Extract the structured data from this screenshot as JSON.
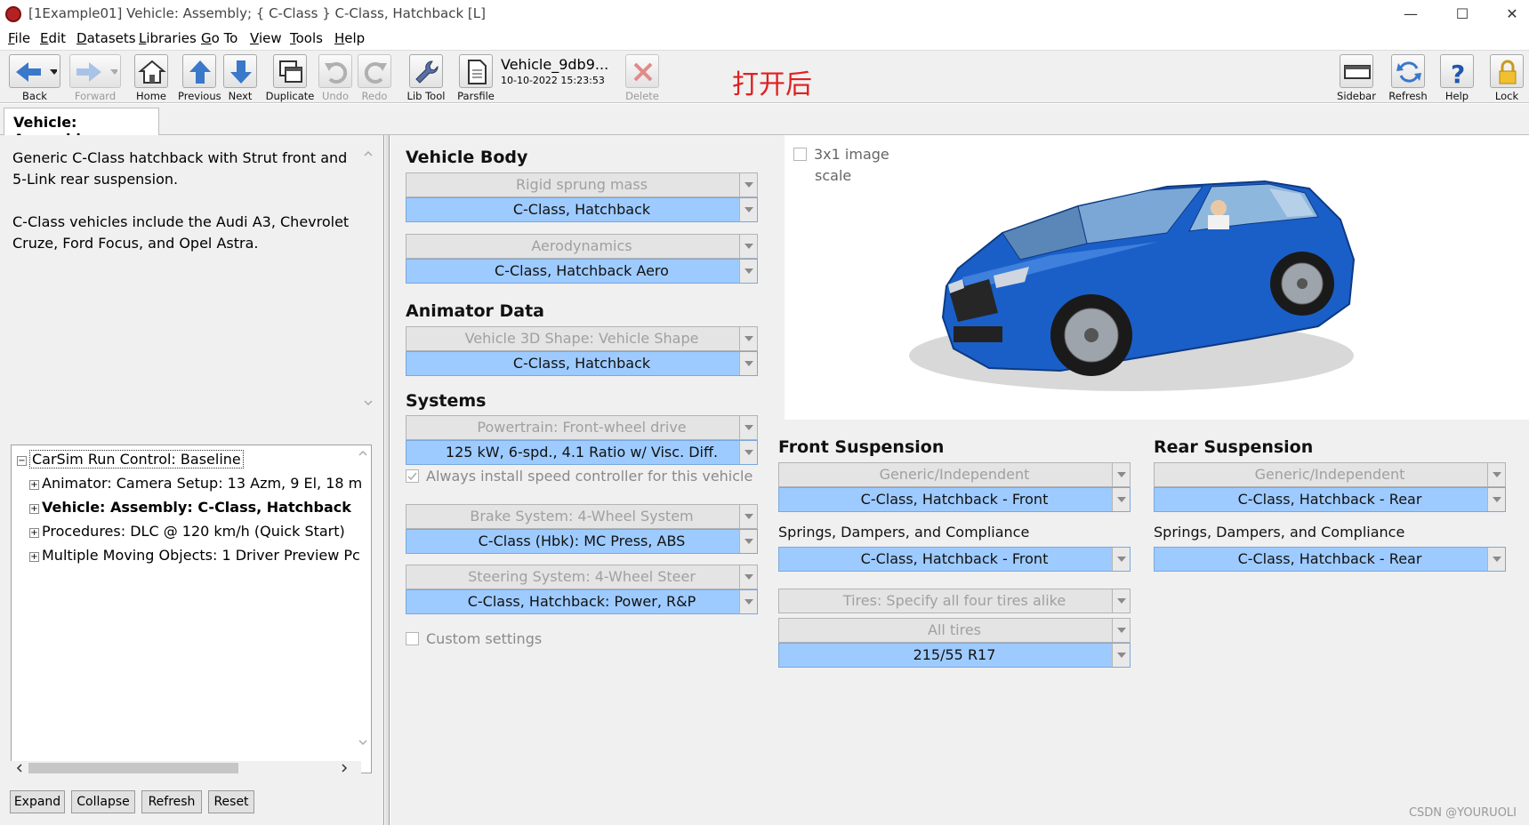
{
  "window": {
    "title": "[1Example01] Vehicle: Assembly; { C-Class } C-Class, Hatchback [L]",
    "minimize": "—",
    "maximize": "☐",
    "close": "✕"
  },
  "menu": [
    "File",
    "Edit",
    "Datasets",
    "Libraries",
    "Go To",
    "View",
    "Tools",
    "Help"
  ],
  "toolbar": {
    "back": "Back",
    "forward": "Forward",
    "home": "Home",
    "previous": "Previous",
    "next": "Next",
    "duplicate": "Duplicate",
    "undo": "Undo",
    "redo": "Redo",
    "libtool": "Lib Tool",
    "parsfile": "Parsfile",
    "delete": "Delete",
    "sidebar": "Sidebar",
    "refresh": "Refresh",
    "help": "Help",
    "lock": "Lock",
    "dataset_name": "Vehicle_9db9...",
    "dataset_date": "10-10-2022 15:23:53"
  },
  "annotation": "打开后",
  "tab_label": "Vehicle: Assembly",
  "notes": {
    "p1": "Generic C-Class hatchback with Strut front and 5-Link rear suspension.",
    "p2": "C-Class vehicles include the Audi A3, Chevrolet Cruze, Ford Focus, and Opel Astra."
  },
  "tree": {
    "root": "CarSim Run Control: Baseline",
    "items": [
      "Animator: Camera Setup: 13 Azm, 9 El, 18 m",
      "Vehicle: Assembly: C-Class, Hatchback",
      "Procedures: DLC @ 120 km/h (Quick Start)",
      "Multiple Moving Objects: 1 Driver Preview Pc"
    ]
  },
  "tree_buttons": [
    "Expand",
    "Collapse",
    "Refresh",
    "Reset"
  ],
  "vehicle_body": {
    "title": "Vehicle Body",
    "rigid_label": "Rigid sprung mass",
    "rigid_value": "C-Class, Hatchback",
    "aero_label": "Aerodynamics",
    "aero_value": "C-Class, Hatchback Aero"
  },
  "animator": {
    "title": "Animator Data",
    "shape_label": "Vehicle 3D Shape: Vehicle Shape",
    "shape_value": "C-Class, Hatchback"
  },
  "systems": {
    "title": "Systems",
    "powertrain_label": "Powertrain: Front-wheel drive",
    "powertrain_value": "125 kW, 6-spd., 4.1 Ratio w/ Visc. Diff.",
    "speed_ctrl": "Always install speed controller for this vehicle",
    "brake_label": "Brake System: 4-Wheel System",
    "brake_value": "C-Class (Hbk): MC Press, ABS",
    "steering_label": "Steering System: 4-Wheel Steer",
    "steering_value": "C-Class, Hatchback: Power, R&P",
    "custom": "Custom settings"
  },
  "image_options": {
    "scale_label": "3x1 image",
    "scale_label2": "scale"
  },
  "front_susp": {
    "title": "Front Suspension",
    "type_label": "Generic/Independent",
    "type_value": "C-Class, Hatchback - Front",
    "springs_title": "Springs, Dampers, and Compliance",
    "springs_value": "C-Class, Hatchback - Front"
  },
  "rear_susp": {
    "title": "Rear Suspension",
    "type_label": "Generic/Independent",
    "type_value": "C-Class, Hatchback - Rear",
    "springs_title": "Springs, Dampers, and Compliance",
    "springs_value": "C-Class, Hatchback - Rear"
  },
  "tires": {
    "spec_label": "Tires: Specify all four tires alike",
    "all_label": "All tires",
    "all_value": "215/55 R17"
  },
  "watermark": "CSDN @YOURUOLI",
  "colors": {
    "selected_field": "#9ecbff",
    "annotation": "#e02020",
    "car_body": "#1a5fc8"
  }
}
